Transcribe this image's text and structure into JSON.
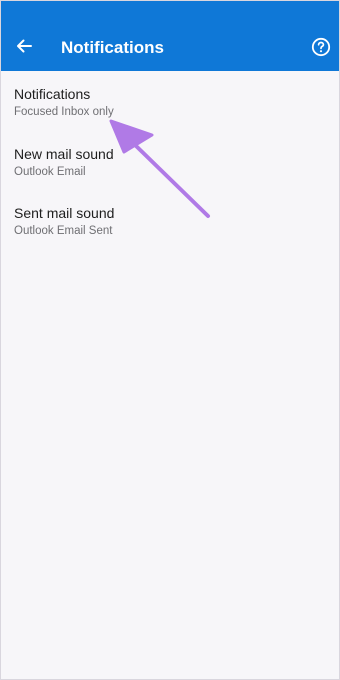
{
  "app_bar": {
    "title": "Notifications",
    "back_icon": "arrow-left-icon",
    "help_icon": "help-circle-icon",
    "background": "#0f78d7"
  },
  "settings": [
    {
      "title": "Notifications",
      "subtitle": "Focused Inbox only"
    },
    {
      "title": "New mail sound",
      "subtitle": "Outlook Email"
    },
    {
      "title": "Sent mail sound",
      "subtitle": "Outlook Email Sent"
    }
  ],
  "annotation": {
    "icon": "pointer-arrow",
    "color": "#b07ae6"
  }
}
